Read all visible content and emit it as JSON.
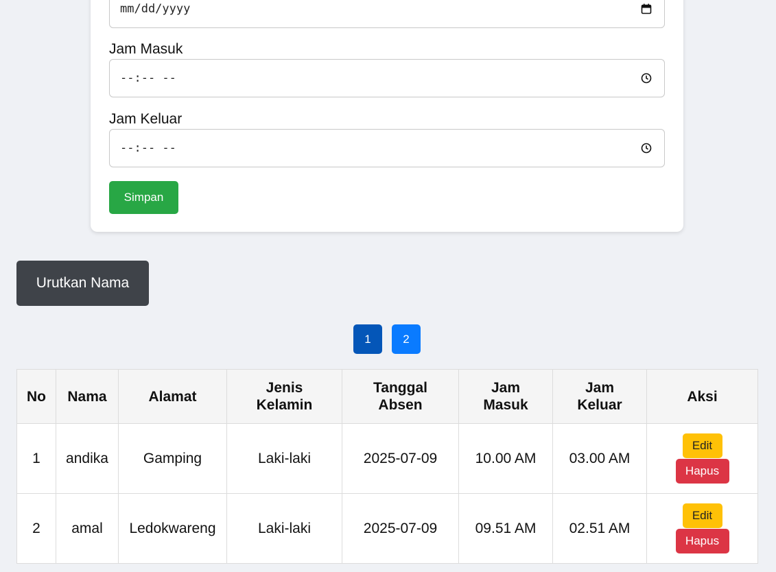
{
  "form": {
    "date_value": "mm/dd/yyyy",
    "jam_masuk_label": "Jam Masuk",
    "jam_masuk_value": "--:-- --",
    "jam_keluar_label": "Jam Keluar",
    "jam_keluar_value": "--:-- --",
    "save_label": "Simpan"
  },
  "sort_label": "Urutkan Nama",
  "pagination": [
    "1",
    "2"
  ],
  "table": {
    "headers": [
      "No",
      "Nama",
      "Alamat",
      "Jenis Kelamin",
      "Tanggal Absen",
      "Jam Masuk",
      "Jam Keluar",
      "Aksi"
    ],
    "rows": [
      {
        "no": "1",
        "nama": "andika",
        "alamat": "Gamping",
        "jk": "Laki-laki",
        "tanggal": "2025-07-09",
        "masuk": "10.00 AM",
        "keluar": "03.00 AM"
      },
      {
        "no": "2",
        "nama": "amal",
        "alamat": "Ledokwareng",
        "jk": "Laki-laki",
        "tanggal": "2025-07-09",
        "masuk": "09.51 AM",
        "keluar": "02.51 AM"
      }
    ],
    "edit_label": "Edit",
    "delete_label": "Hapus"
  }
}
